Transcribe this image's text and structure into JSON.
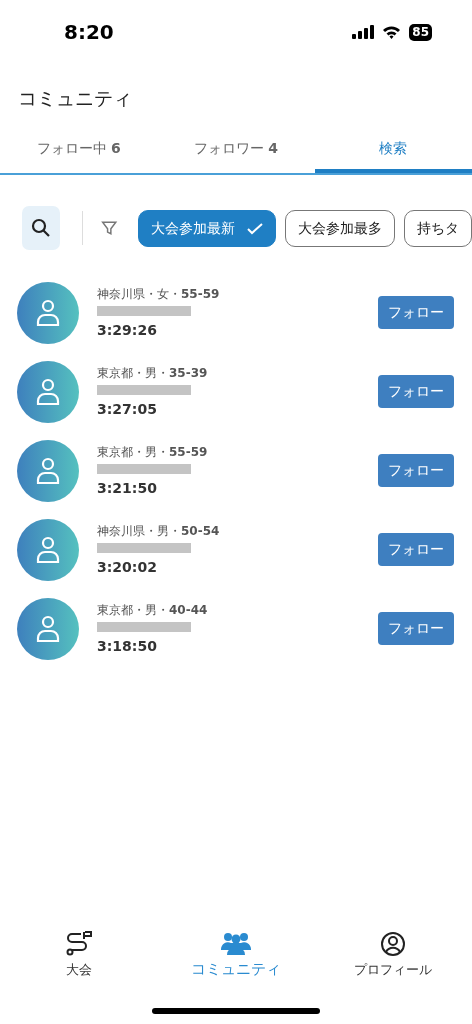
{
  "status_bar": {
    "time": "8:20",
    "battery": "85"
  },
  "header": {
    "title": "コミュニティ"
  },
  "tabs": [
    {
      "label": "フォロー中 **6**",
      "selected": false
    },
    {
      "label": "フォロワー **4**",
      "selected": false
    },
    {
      "label": "検索",
      "selected": true
    }
  ],
  "filters": [
    {
      "label": "大会参加最新",
      "selected": true
    },
    {
      "label": "大会参加最多",
      "selected": false
    },
    {
      "label": "持ちタ",
      "selected": false
    }
  ],
  "users": [
    {
      "meta": "神奈川県・女・**55-59**",
      "time": "3:29:26",
      "button": "フォロー"
    },
    {
      "meta": "東京都・男・**35-39**",
      "time": "3:27:05",
      "button": "フォロー"
    },
    {
      "meta": "東京都・男・**55-59**",
      "time": "3:21:50",
      "button": "フォロー"
    },
    {
      "meta": "神奈川県・男・**50-54**",
      "time": "3:20:02",
      "button": "フォロー"
    },
    {
      "meta": "東京都・男・**40-44**",
      "time": "3:18:50",
      "button": "フォロー"
    }
  ],
  "bottom_nav": [
    {
      "kind": "race",
      "label": "大会",
      "selected": false
    },
    {
      "kind": "community",
      "label": "コミュニティ",
      "selected": true
    },
    {
      "kind": "profile",
      "label": "プロフィール",
      "selected": false
    }
  ]
}
